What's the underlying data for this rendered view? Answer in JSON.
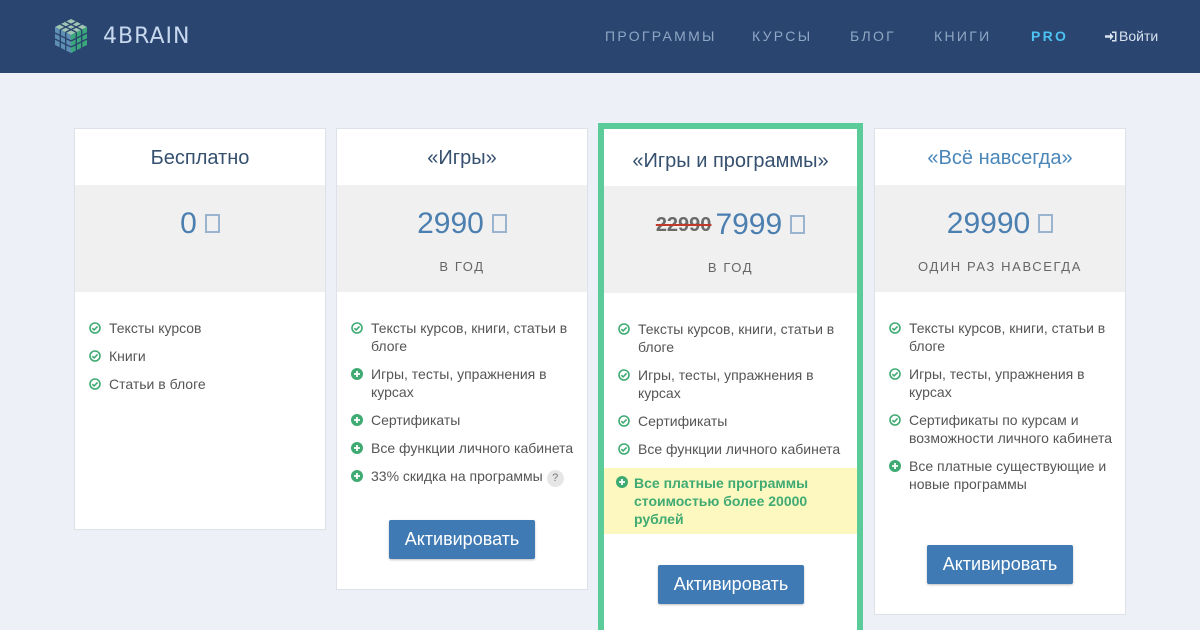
{
  "header": {
    "logo_text": "4BRAIN",
    "nav": [
      {
        "label": "ПРОГРАММЫ"
      },
      {
        "label": "КУРСЫ"
      },
      {
        "label": "БЛОГ"
      },
      {
        "label": "КНИГИ"
      },
      {
        "label": "PRO"
      }
    ],
    "login_label": "Войти"
  },
  "plans": [
    {
      "title": "Бесплатно",
      "price": "0",
      "period": "",
      "features": [
        {
          "text": "Тексты курсов",
          "icon": "check-circle-icon"
        },
        {
          "text": "Книги",
          "icon": "check-circle-icon"
        },
        {
          "text": "Статьи в блоге",
          "icon": "check-circle-icon"
        }
      ]
    },
    {
      "title": "«Игры»",
      "price": "2990",
      "period": "В ГОД",
      "features": [
        {
          "text": "Тексты курсов, книги, статьи в блоге",
          "icon": "check-circle-icon"
        },
        {
          "text": "Игры, тесты, упражнения в курсах",
          "icon": "plus-circle-icon"
        },
        {
          "text": "Сертификаты",
          "icon": "plus-circle-icon"
        },
        {
          "text": "Все функции личного кабинета",
          "icon": "plus-circle-icon"
        },
        {
          "text": "33% скидка на программы",
          "icon": "plus-circle-icon",
          "help": "?"
        }
      ],
      "button": "Активировать"
    },
    {
      "title": "«Игры и программы»",
      "old_price": "22990",
      "price": "7999",
      "period": "В ГОД",
      "features": [
        {
          "text": "Тексты курсов, книги, статьи в блоге",
          "icon": "check-circle-icon"
        },
        {
          "text": "Игры, тесты, упражнения в курсах",
          "icon": "check-circle-icon"
        },
        {
          "text": "Сертификаты",
          "icon": "check-circle-icon"
        },
        {
          "text": "Все функции личного кабинета",
          "icon": "check-circle-icon"
        },
        {
          "text": "Все платные программы стоимостью более 20000 рублей",
          "icon": "plus-circle-icon",
          "highlight": true
        }
      ],
      "button": "Активировать"
    },
    {
      "title": "«Всё навсегда»",
      "price": "29990",
      "period": "ОДИН РАЗ НАВСЕГДА",
      "features": [
        {
          "text": "Тексты курсов, книги, статьи в блоге",
          "icon": "check-circle-icon"
        },
        {
          "text": "Игры, тесты, упражнения в курсах",
          "icon": "check-circle-icon"
        },
        {
          "text": "Сертификаты по курсам и возможности личного кабинета",
          "icon": "check-circle-icon"
        },
        {
          "text": "Все платные существующие и новые программы",
          "icon": "plus-circle-icon"
        }
      ],
      "button": "Активировать"
    }
  ],
  "colors": {
    "header_bg": "#2a4570",
    "accent_blue": "#3f7ab4",
    "featured_border": "#5bcb9a",
    "icon_green": "#3faa72",
    "highlight_bg": "#fcf8c0",
    "pro_nav": "#4cc3f2"
  }
}
